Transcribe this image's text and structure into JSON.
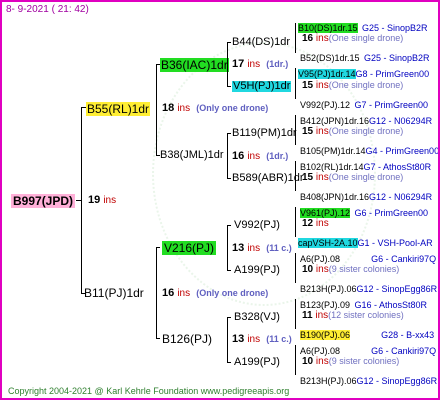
{
  "date": "8-  9-2021  ( 21: 42)",
  "copyright": "Copyright 2004-2021 @ Karl Kehrle Foundation    www.pedigreeapis.org",
  "root": {
    "name": "B997(JPD)",
    "num": "19",
    "ins": "ins"
  },
  "g1": [
    {
      "name": "B55(RL)1dr",
      "num": "18",
      "ins": "ins",
      "note": "(Only one drone)"
    },
    {
      "name": "B11(PJ)1dr",
      "num": "16",
      "ins": "ins",
      "note": "(Only one drone)"
    }
  ],
  "g2": [
    {
      "name": "B36(IAC)1dr",
      "num": "17",
      "ins": "ins",
      "note": "(1dr.)"
    },
    {
      "name": "B38(JML)1dr",
      "num": "16",
      "ins": "ins",
      "note": "(1dr.)"
    },
    {
      "name": "V216(PJ)",
      "num": "13",
      "ins": "ins",
      "note": "(11 c.)"
    },
    {
      "name": "B126(PJ)",
      "num": "13",
      "ins": "ins",
      "note": "(11 c.)"
    }
  ],
  "g3": [
    {
      "name": "B44(DS)1dr"
    },
    {
      "name": "V5H(PJ)1dr"
    },
    {
      "name": "B119(PM)1dr"
    },
    {
      "name": "B589(ABR)1dr"
    },
    {
      "name": "V992(PJ)"
    },
    {
      "name": "A199(PJ)"
    },
    {
      "name": "B328(VJ)"
    },
    {
      "name": "A199(PJ)"
    }
  ],
  "leaves": [
    {
      "top": "B10(DS)1dr.15",
      "top_suffix": "G25 - SinopB2R",
      "num": "16",
      "ins": "ins",
      "note": "(One single drone)",
      "bot": "B52(DS)1dr.15",
      "bot_suffix": "G25 - SinopB2R"
    },
    {
      "top": "V95(PJ)1dr.14",
      "top_suffix": "G8 - PrimGreen00",
      "num": "15",
      "ins": "ins",
      "note": "(One single drone)",
      "bot": "V992(PJ).12",
      "bot_suffix": "G7 - PrimGreen00"
    },
    {
      "top": "B412(JPN)1dr.16",
      "top_suffix": "G12 - N06294R",
      "num": "15",
      "ins": "ins",
      "note": "(One single drone)",
      "bot": "B105(PM)1dr.14",
      "bot_suffix": "G4 - PrimGreen00"
    },
    {
      "top": "B102(RL)1dr.14",
      "top_suffix": "G7 - AthosSt80R",
      "num": "15",
      "ins": "ins",
      "note": "(One single drone)",
      "bot": "B408(JPN)1dr.16",
      "bot_suffix": "G12 - N06294R"
    },
    {
      "top": "V961(PJ).12",
      "top_suffix": "G6 - PrimGreen00",
      "num": "12",
      "ins": "ins",
      "note": "",
      "bot": "capVSH-2A.10",
      "bot_suffix": "G1 - VSH-Pool-AR"
    },
    {
      "top": "A6(PJ).08",
      "top_suffix": "G6 - Cankiri97Q",
      "num": "10",
      "ins": "ins",
      "note": "(9 sister colonies)",
      "bot": "B213H(PJ).06",
      "bot_suffix": "G12 - SinopEgg86R"
    },
    {
      "top": "B123(PJ).09",
      "top_suffix": "G16 - AthosSt80R",
      "num": "11",
      "ins": "ins",
      "note": "(12 sister colonies)",
      "bot": "B190(PJ).06",
      "bot_suffix": "G28 - B-xx43"
    },
    {
      "top": "A6(PJ).08",
      "top_suffix": "G6 - Cankiri97Q",
      "num": "10",
      "ins": "ins",
      "note": "(9 sister colonies)",
      "bot": "B213H(PJ).06",
      "bot_suffix": "G12 - SinopEgg86R"
    }
  ]
}
